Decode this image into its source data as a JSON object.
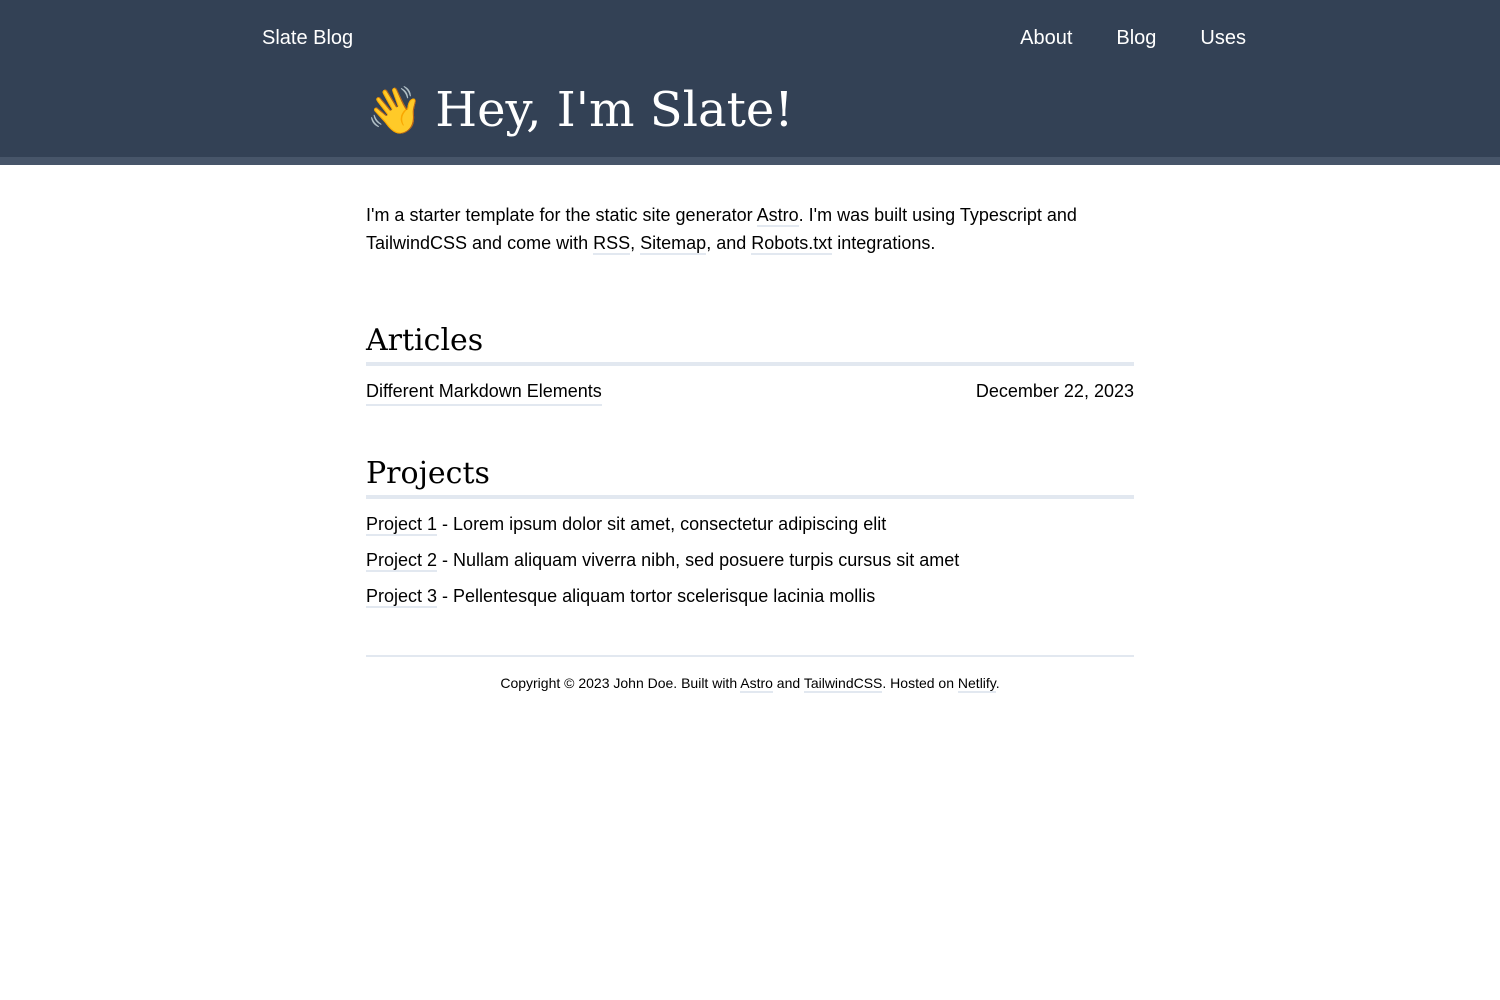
{
  "header": {
    "brand": "Slate Blog",
    "nav": [
      "About",
      "Blog",
      "Uses"
    ],
    "wave_emoji": "👋",
    "hero_title": "Hey, I'm Slate!"
  },
  "intro": {
    "part1": "I'm a starter template for the static site generator ",
    "astro": "Astro",
    "part2": ". I'm was built using Typescript and TailwindCSS and come with ",
    "rss": "RSS",
    "sep1": ", ",
    "sitemap": "Sitemap",
    "sep2": ", and ",
    "robots": "Robots.txt",
    "part3": " integrations."
  },
  "articles": {
    "title": "Articles",
    "items": [
      {
        "title": "Different Markdown Elements",
        "date": "December 22, 2023"
      }
    ]
  },
  "projects": {
    "title": "Projects",
    "items": [
      {
        "name": "Project 1",
        "desc": " - Lorem ipsum dolor sit amet, consectetur adipiscing elit"
      },
      {
        "name": "Project 2",
        "desc": " - Nullam aliquam viverra nibh, sed posuere turpis cursus sit amet"
      },
      {
        "name": "Project 3",
        "desc": " - Pellentesque aliquam tortor scelerisque lacinia mollis"
      }
    ]
  },
  "footer": {
    "part1": "Copyright © 2023 John Doe. Built with ",
    "astro": "Astro",
    "and": " and ",
    "tailwind": "TailwindCSS",
    "hosted": ". Hosted on ",
    "netlify": "Netlify",
    "end": "."
  },
  "colors": {
    "header_bg": "#334155",
    "header_band": "#475569",
    "rule": "#e2e8f0"
  }
}
